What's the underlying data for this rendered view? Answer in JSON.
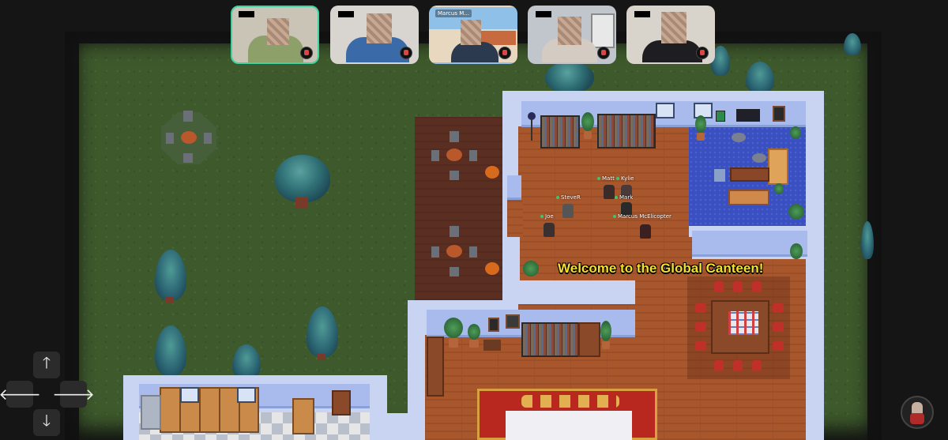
{
  "video_tiles": [
    {
      "name": "",
      "active": true
    },
    {
      "name": "",
      "active": false
    },
    {
      "name": "Marcus M...",
      "active": false
    },
    {
      "name": "",
      "active": false
    },
    {
      "name": "",
      "active": false
    }
  ],
  "map": {
    "welcome_text": "Welcome to the Global Canteen!",
    "players": [
      {
        "name": "Matt"
      },
      {
        "name": "Kylie"
      },
      {
        "name": "Mark"
      },
      {
        "name": "SteveR"
      },
      {
        "name": "Joe"
      },
      {
        "name": "Marcus McElicopter"
      }
    ]
  },
  "controls": {
    "up_icon": "arrow-up-icon",
    "down_icon": "arrow-down-icon",
    "left_icon": "arrow-left-icon",
    "right_icon": "arrow-right-icon",
    "up_glyph": "🡑",
    "down_glyph": "🡓",
    "left_glyph": "🡐",
    "right_glyph": "🡒"
  },
  "colors": {
    "grass": "#3e5a2c",
    "active_tile_border": "#3fd3a0",
    "welcome_text": "#f5e02a",
    "presence_dot": "#3ec46d"
  }
}
